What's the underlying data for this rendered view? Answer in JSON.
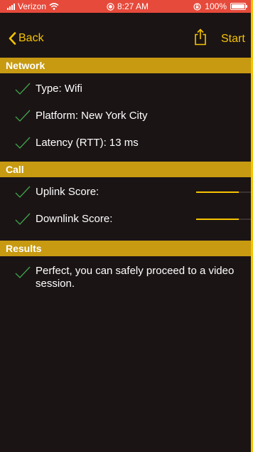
{
  "status_bar": {
    "carrier": "Verizon",
    "time": "8:27 AM",
    "battery_percent": "100%",
    "colors": {
      "background": "#E64A3B",
      "text": "#FFFFFF"
    }
  },
  "nav": {
    "back_label": "Back",
    "start_label": "Start",
    "icons": {
      "back": "chevron-left-icon",
      "share": "share-icon"
    },
    "accent_color": "#F5C400"
  },
  "sections": {
    "network": {
      "title": "Network",
      "items": [
        {
          "label": "Type: Wifi"
        },
        {
          "label": "Platform: New York City"
        },
        {
          "label": "Latency (RTT): 13 ms"
        }
      ]
    },
    "call": {
      "title": "Call",
      "items": [
        {
          "label": "Uplink Score:",
          "score_fill_percent": 75
        },
        {
          "label": "Downlink Score:",
          "score_fill_percent": 75
        }
      ]
    },
    "results": {
      "title": "Results",
      "items": [
        {
          "label": "Perfect, you can safely proceed to a video session."
        }
      ]
    }
  },
  "colors": {
    "background": "#1B1415",
    "section_header": "#C79A11",
    "accent": "#F5C400",
    "check": "#3FA64A"
  }
}
